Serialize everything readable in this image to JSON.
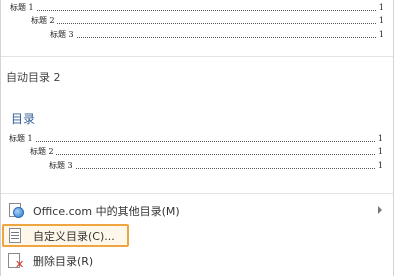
{
  "gallery": {
    "top_entries": [
      {
        "label": "标题 1",
        "page": "1"
      },
      {
        "label": "标题 2",
        "page": "1"
      },
      {
        "label": "标题 3",
        "page": "1"
      }
    ],
    "auto_toc_2": {
      "title": "自动目录 2",
      "preview_heading": "目录",
      "entries": [
        {
          "label": "标题 1",
          "page": "1"
        },
        {
          "label": "标题 2",
          "page": "1"
        },
        {
          "label": "标题 3",
          "page": "1"
        }
      ]
    }
  },
  "menu": {
    "office": {
      "label": "Office.com 中的其他目录(M)",
      "icon": "office-globe-icon"
    },
    "custom": {
      "label": "自定义目录(C)...",
      "icon": "custom-toc-icon",
      "highlight_color": "#f0a640"
    },
    "remove": {
      "label": "删除目录(R)",
      "icon": "remove-toc-icon",
      "icon_color": "#d9331f"
    }
  }
}
